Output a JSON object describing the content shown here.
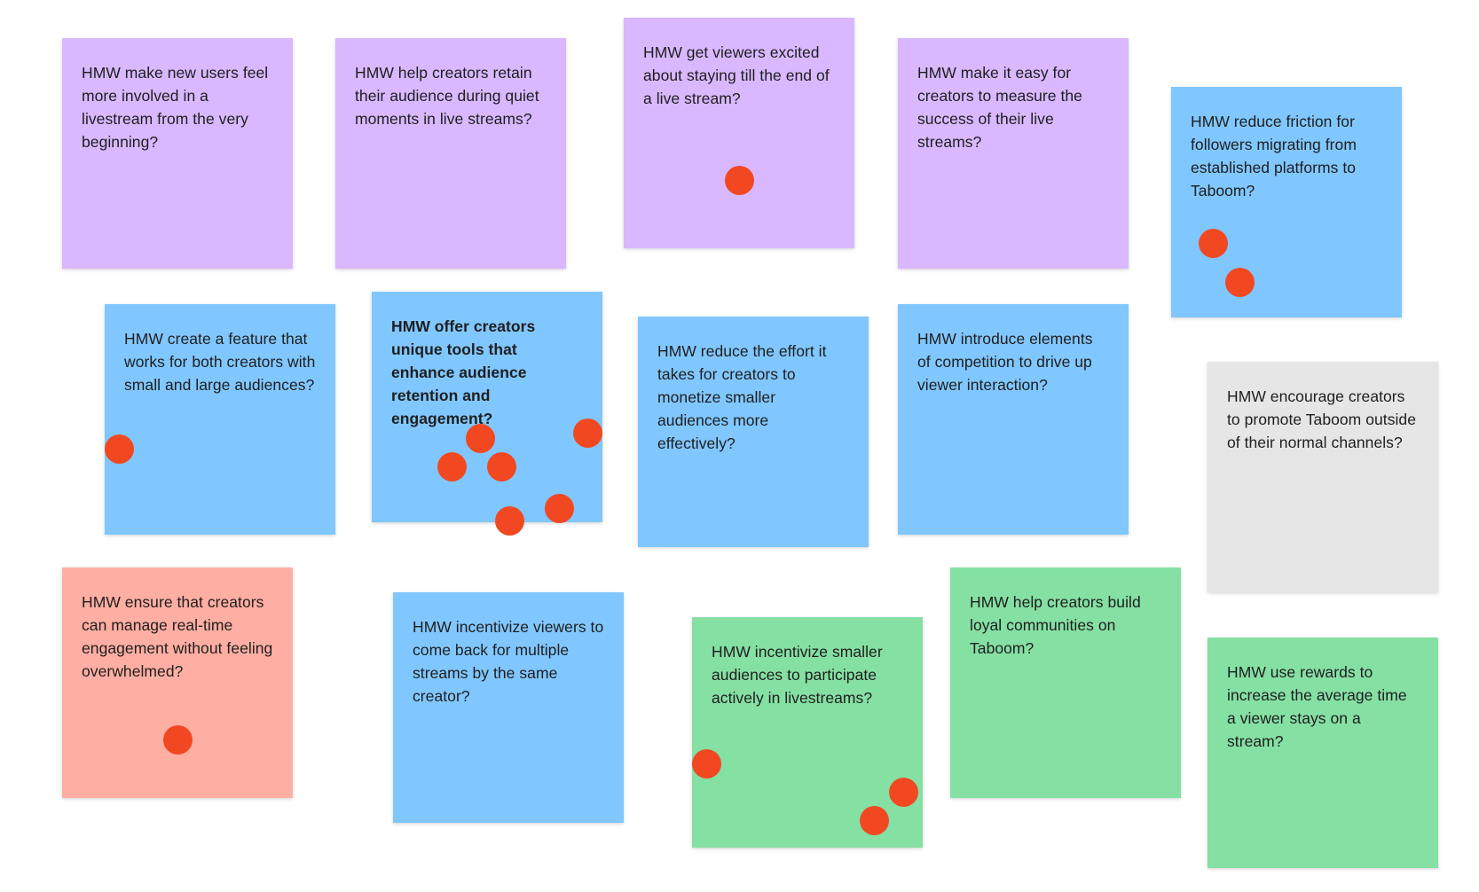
{
  "board": {
    "notes": [
      {
        "text": "HMW make new users feel more involved in a livestream from the very beginning?",
        "color": "#d9b8ff",
        "votes": 0
      },
      {
        "text": "HMW help creators retain their audience during quiet moments in live streams?",
        "color": "#d9b8ff",
        "votes": 0
      },
      {
        "text": "HMW get viewers excited about staying till the end of a live stream?",
        "color": "#d9b8ff",
        "votes": 1
      },
      {
        "text": "HMW make it easy for creators to measure the success of their live streams?",
        "color": "#d9b8ff",
        "votes": 0
      },
      {
        "text": "HMW reduce friction for followers migrating from established platforms to Taboom?",
        "color": "#80c7ff",
        "votes": 2
      },
      {
        "text": "HMW create a feature that works for both creators with small and large audiences?",
        "color": "#80c7ff",
        "votes": 1
      },
      {
        "text": "HMW offer creators unique tools that enhance audience retention and engagement?",
        "color": "#80c7ff",
        "votes": 6,
        "bold": true
      },
      {
        "text": "HMW reduce the effort it takes for creators to monetize smaller audiences more effectively?",
        "color": "#80c7ff",
        "votes": 0
      },
      {
        "text": "HMW introduce elements of competition to drive up viewer interaction?",
        "color": "#80c7ff",
        "votes": 0
      },
      {
        "text": "HMW encourage creators to promote Taboom outside of their normal channels?",
        "color": "#e6e6e6",
        "votes": 0
      },
      {
        "text": "HMW ensure that creators can manage real-time engagement without feeling overwhelmed?",
        "color": "#ffaea3",
        "votes": 1
      },
      {
        "text": "HMW incentivize viewers to come back for multiple streams by the same creator?",
        "color": "#80c7ff",
        "votes": 0
      },
      {
        "text": "HMW incentivize smaller audiences to participate actively in livestreams?",
        "color": "#85e0a3",
        "votes": 3
      },
      {
        "text": "HMW help creators build loyal communities on Taboom?",
        "color": "#85e0a3",
        "votes": 0
      },
      {
        "text": "HMW use rewards to increase the average time a viewer stays on a stream?",
        "color": "#85e0a3",
        "votes": 0
      }
    ],
    "vote_dot_color": "#f24822"
  }
}
